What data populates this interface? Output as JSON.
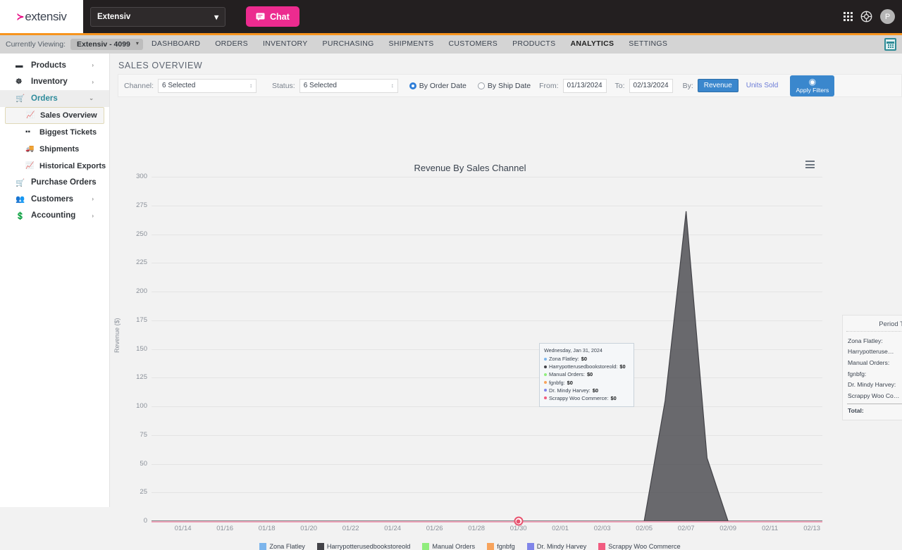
{
  "topbar": {
    "logo_mark": "≻",
    "logo_text": "extensiv",
    "org_value": "Extensiv",
    "chat_label": "Chat",
    "chevron": "⌄",
    "chat_icon": "chat-bubble-icon",
    "grid_icon": "app-grid-icon",
    "support_icon": "lifebuoy-icon",
    "avatar_initial": "P"
  },
  "navbar": {
    "viewing_label": "Currently Viewing:",
    "viewing_value": "Extensiv - 4099",
    "items": [
      {
        "label": "DASHBOARD",
        "active": false
      },
      {
        "label": "ORDERS",
        "active": false
      },
      {
        "label": "INVENTORY",
        "active": false
      },
      {
        "label": "PURCHASING",
        "active": false
      },
      {
        "label": "SHIPMENTS",
        "active": false
      },
      {
        "label": "CUSTOMERS",
        "active": false
      },
      {
        "label": "PRODUCTS",
        "active": false
      },
      {
        "label": "ANALYTICS",
        "active": true
      },
      {
        "label": "SETTINGS",
        "active": false
      }
    ],
    "calculator_icon": "calculator-icon"
  },
  "sidebar": {
    "items": [
      {
        "label": "Products",
        "icon": "▐▐",
        "arrow": "›"
      },
      {
        "label": "Inventory",
        "icon": "☸",
        "arrow": "›"
      },
      {
        "label": "Orders",
        "icon": "⛟",
        "arrow": "⌄",
        "open": true
      }
    ],
    "sub_items": [
      {
        "label": "Sales Overview",
        "icon": "Ὄ8",
        "selected": true
      },
      {
        "label": "Biggest Tickets",
        "icon": "▤",
        "selected": false
      },
      {
        "label": "Shipments",
        "icon": "⛟",
        "selected": false
      },
      {
        "label": "Historical Exports",
        "icon": "Ὄ8",
        "selected": false
      }
    ],
    "items_after": [
      {
        "label": "Purchase Orders",
        "icon": "⛟",
        "arrow": "›"
      },
      {
        "label": "Customers",
        "icon": "☺",
        "arrow": "›"
      },
      {
        "label": "Accounting",
        "icon": "▣",
        "arrow": "›"
      }
    ]
  },
  "page": {
    "title": "SALES OVERVIEW"
  },
  "filters": {
    "channel_label": "Channel:",
    "channel_value": "6 Selected",
    "status_label": "Status:",
    "status_value": "6 Selected",
    "by_order_date": "By Order Date",
    "by_ship_date": "By Ship Date",
    "from_label": "From:",
    "from_value": "01/13/2024",
    "to_label": "To:",
    "to_value": "02/13/2024",
    "by_label": "By:",
    "revenue_label": "Revenue",
    "units_sold_label": "Units Sold",
    "apply_label": "Apply Filters",
    "apply_icon": "play-circle-icon",
    "stepper_glyph": "↕"
  },
  "chart_panel": {
    "title": "Revenue By Sales Channel",
    "menu_icon": "hamburger-menu-icon"
  },
  "chart_data": {
    "type": "area",
    "title": "Revenue By Sales Channel",
    "xlabel": "",
    "ylabel": "Revenue ($)",
    "ylim": [
      0,
      300
    ],
    "yticks": [
      0,
      25,
      50,
      75,
      100,
      125,
      150,
      175,
      200,
      225,
      250,
      275,
      300
    ],
    "xticks": [
      "01/14",
      "01/16",
      "01/18",
      "01/20",
      "01/22",
      "01/24",
      "01/26",
      "01/28",
      "01/30",
      "02/01",
      "02/03",
      "02/05",
      "02/07",
      "02/09",
      "02/11",
      "02/13"
    ],
    "grid": true,
    "legend_position": "bottom",
    "series": [
      {
        "name": "Zona Flatley",
        "color": "#7cb5ec",
        "values": [
          0,
          0,
          0,
          0,
          0,
          0,
          0,
          0,
          0,
          0,
          0,
          0,
          0,
          0,
          0,
          0,
          0,
          0,
          0,
          0,
          0,
          0,
          0,
          0,
          0,
          0,
          0,
          0,
          0,
          0,
          0,
          0
        ]
      },
      {
        "name": "Harrypotterusedbookstoreold",
        "color": "#434348",
        "values": [
          0,
          0,
          0,
          0,
          0,
          0,
          0,
          0,
          0,
          0,
          0,
          0,
          0,
          0,
          0,
          0,
          0,
          0,
          0,
          0,
          0,
          0,
          0,
          0,
          105,
          270,
          55,
          0,
          0,
          0,
          0,
          0
        ]
      },
      {
        "name": "Manual Orders",
        "color": "#90ed7d",
        "values": [
          0,
          0,
          0,
          0,
          0,
          0,
          0,
          0,
          0,
          0,
          0,
          0,
          0,
          0,
          0,
          0,
          0,
          0,
          0,
          0,
          0,
          0,
          0,
          0,
          0,
          0,
          0,
          0,
          0,
          0,
          0,
          0
        ]
      },
      {
        "name": "fgnbfg",
        "color": "#f7a35c",
        "values": [
          0,
          0,
          0,
          0,
          0,
          0,
          0,
          0,
          0,
          0,
          0,
          0,
          0,
          0,
          0,
          0,
          0,
          0,
          0,
          0,
          0,
          0,
          0,
          0,
          0,
          0,
          0,
          0,
          0,
          0,
          0,
          0
        ]
      },
      {
        "name": "Dr. Mindy Harvey",
        "color": "#8085e9",
        "values": [
          0,
          0,
          0,
          0,
          0,
          0,
          0,
          0,
          0,
          0,
          0,
          0,
          0,
          0,
          0,
          0,
          0,
          0,
          0,
          0,
          0,
          0,
          0,
          0,
          0,
          0,
          0,
          0,
          0,
          0,
          0,
          0
        ]
      },
      {
        "name": "Scrappy Woo Commerce",
        "color": "#f15c80",
        "values": [
          0,
          0,
          0,
          0,
          0,
          0,
          0,
          0,
          0,
          0,
          0,
          0,
          0,
          0,
          0,
          0,
          0,
          0,
          0,
          0,
          0,
          0,
          0,
          0,
          0,
          0,
          0,
          0,
          0,
          0,
          0,
          0
        ]
      }
    ],
    "marker": {
      "x": "01/31",
      "value": 0,
      "color": "#e8536f"
    }
  },
  "tooltip": {
    "date": "Wednesday, Jan 31, 2024",
    "rows": [
      {
        "name": "Zona Flatley:",
        "value": "$0",
        "color": "#7cb5ec"
      },
      {
        "name": "Harrypotterusedbookstoreold:",
        "value": "$0",
        "color": "#434348"
      },
      {
        "name": "Manual Orders:",
        "value": "$0",
        "color": "#90ed7d"
      },
      {
        "name": "fgnbfg:",
        "value": "$0",
        "color": "#f7a35c"
      },
      {
        "name": "Dr. Mindy Harvey:",
        "value": "$0",
        "color": "#8085e9"
      },
      {
        "name": "Scrappy Woo Commerce:",
        "value": "$0",
        "color": "#f15c80"
      }
    ]
  },
  "period_totals": {
    "heading": "Period Totals",
    "rows": [
      {
        "label": "Zona Flatley:"
      },
      {
        "label": "Harrypotteruse…"
      },
      {
        "label": "Manual Orders:"
      },
      {
        "label": "fgnbfg:"
      },
      {
        "label": "Dr. Mindy Harvey:"
      },
      {
        "label": "Scrappy Woo Co…"
      }
    ],
    "total_label": "Total:"
  },
  "legend": [
    {
      "label": "Zona Flatley",
      "color": "#7cb5ec"
    },
    {
      "label": "Harrypotterusedbookstoreold",
      "color": "#434348"
    },
    {
      "label": "Manual Orders",
      "color": "#90ed7d"
    },
    {
      "label": "fgnbfg",
      "color": "#f7a35c"
    },
    {
      "label": "Dr. Mindy Harvey",
      "color": "#8085e9"
    },
    {
      "label": "Scrappy Woo Commerce",
      "color": "#f15c80"
    }
  ]
}
